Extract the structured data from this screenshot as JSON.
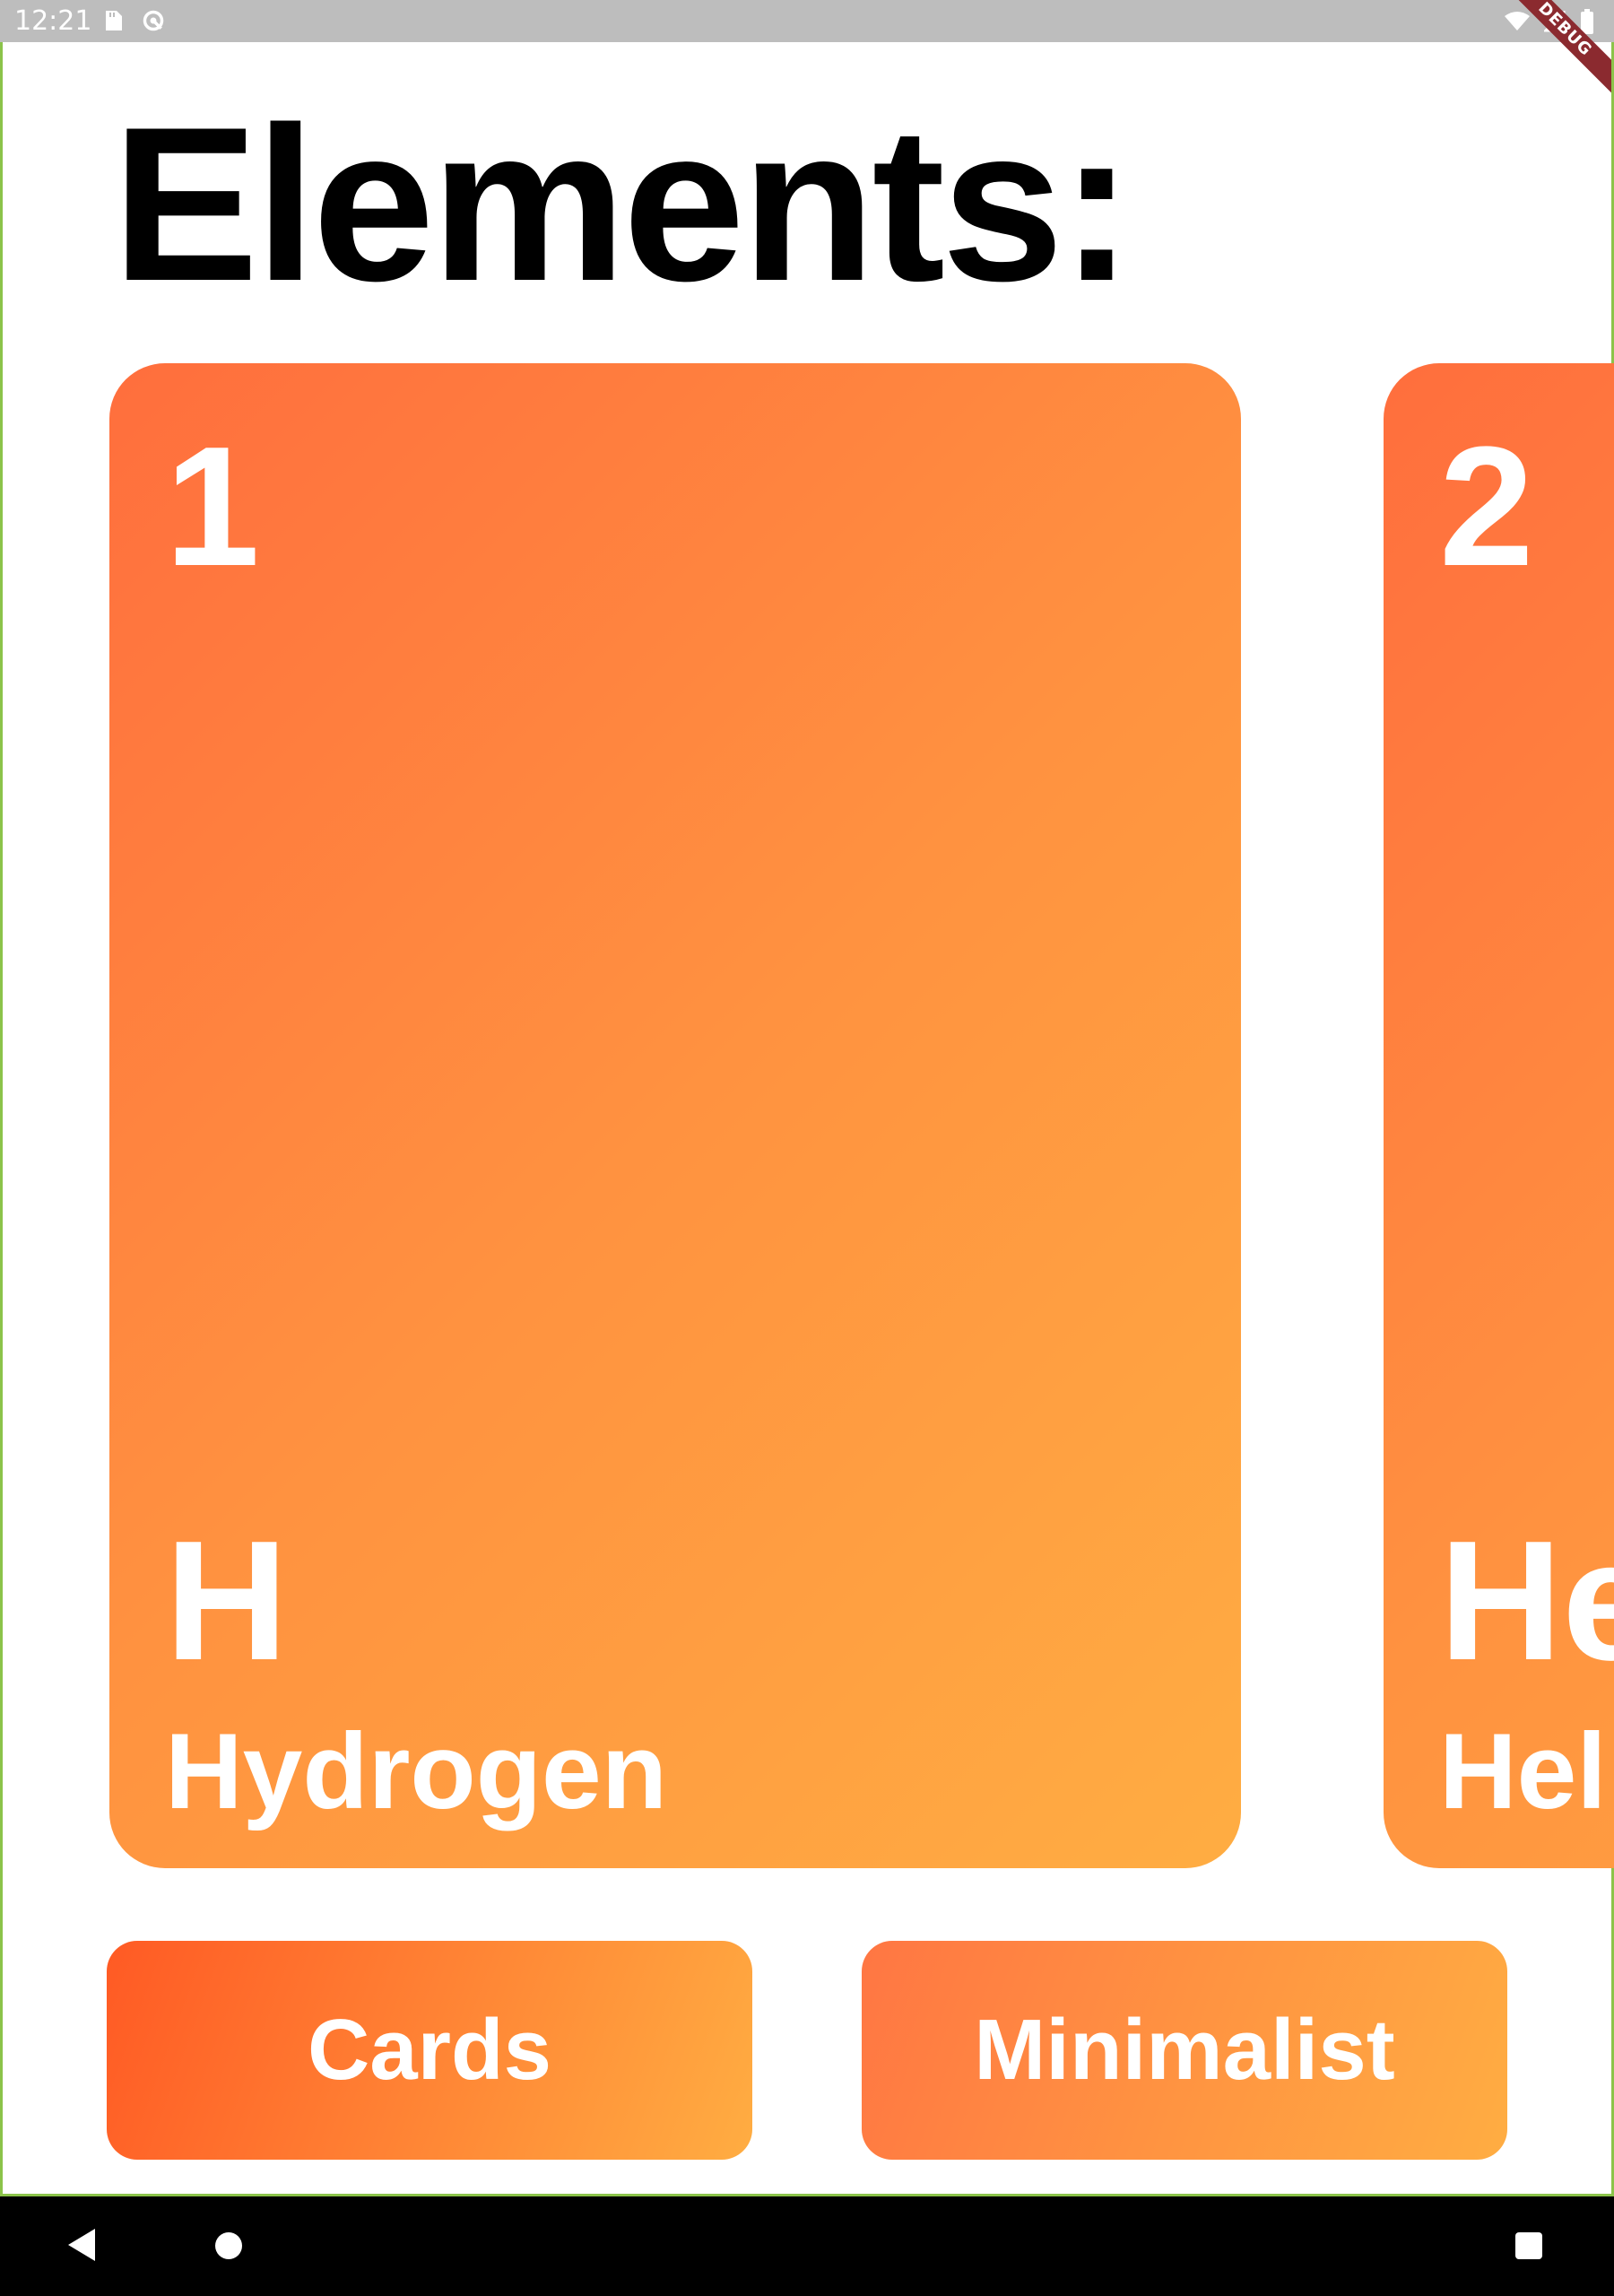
{
  "status_bar": {
    "time": "12:21",
    "icons_left": [
      "sd-card-icon",
      "vpn-icon"
    ],
    "icons_right": [
      "wifi-icon",
      "signal-icon",
      "battery-icon"
    ]
  },
  "debug_banner": "DEBUG",
  "page": {
    "title": "Elements:"
  },
  "elements": [
    {
      "number": "1",
      "symbol": "H",
      "name": "Hydrogen"
    },
    {
      "number": "2",
      "symbol": "He",
      "name": "Helium"
    }
  ],
  "buttons": {
    "cards_label": "Cards",
    "minimalist_label": "Minimalist"
  },
  "nav_bar": {
    "icons": [
      "back-icon",
      "home-icon",
      "recents-icon"
    ]
  },
  "colors": {
    "card_gradient_start": "#ff6e3d",
    "card_gradient_end": "#ffad42",
    "cards_button_start": "#ff5a24",
    "minimalist_button_start": "#ff7643",
    "title": "#000000",
    "card_text": "#ffffff",
    "debug_ribbon": "#8b2a2f",
    "frame": "#8bc34a"
  }
}
